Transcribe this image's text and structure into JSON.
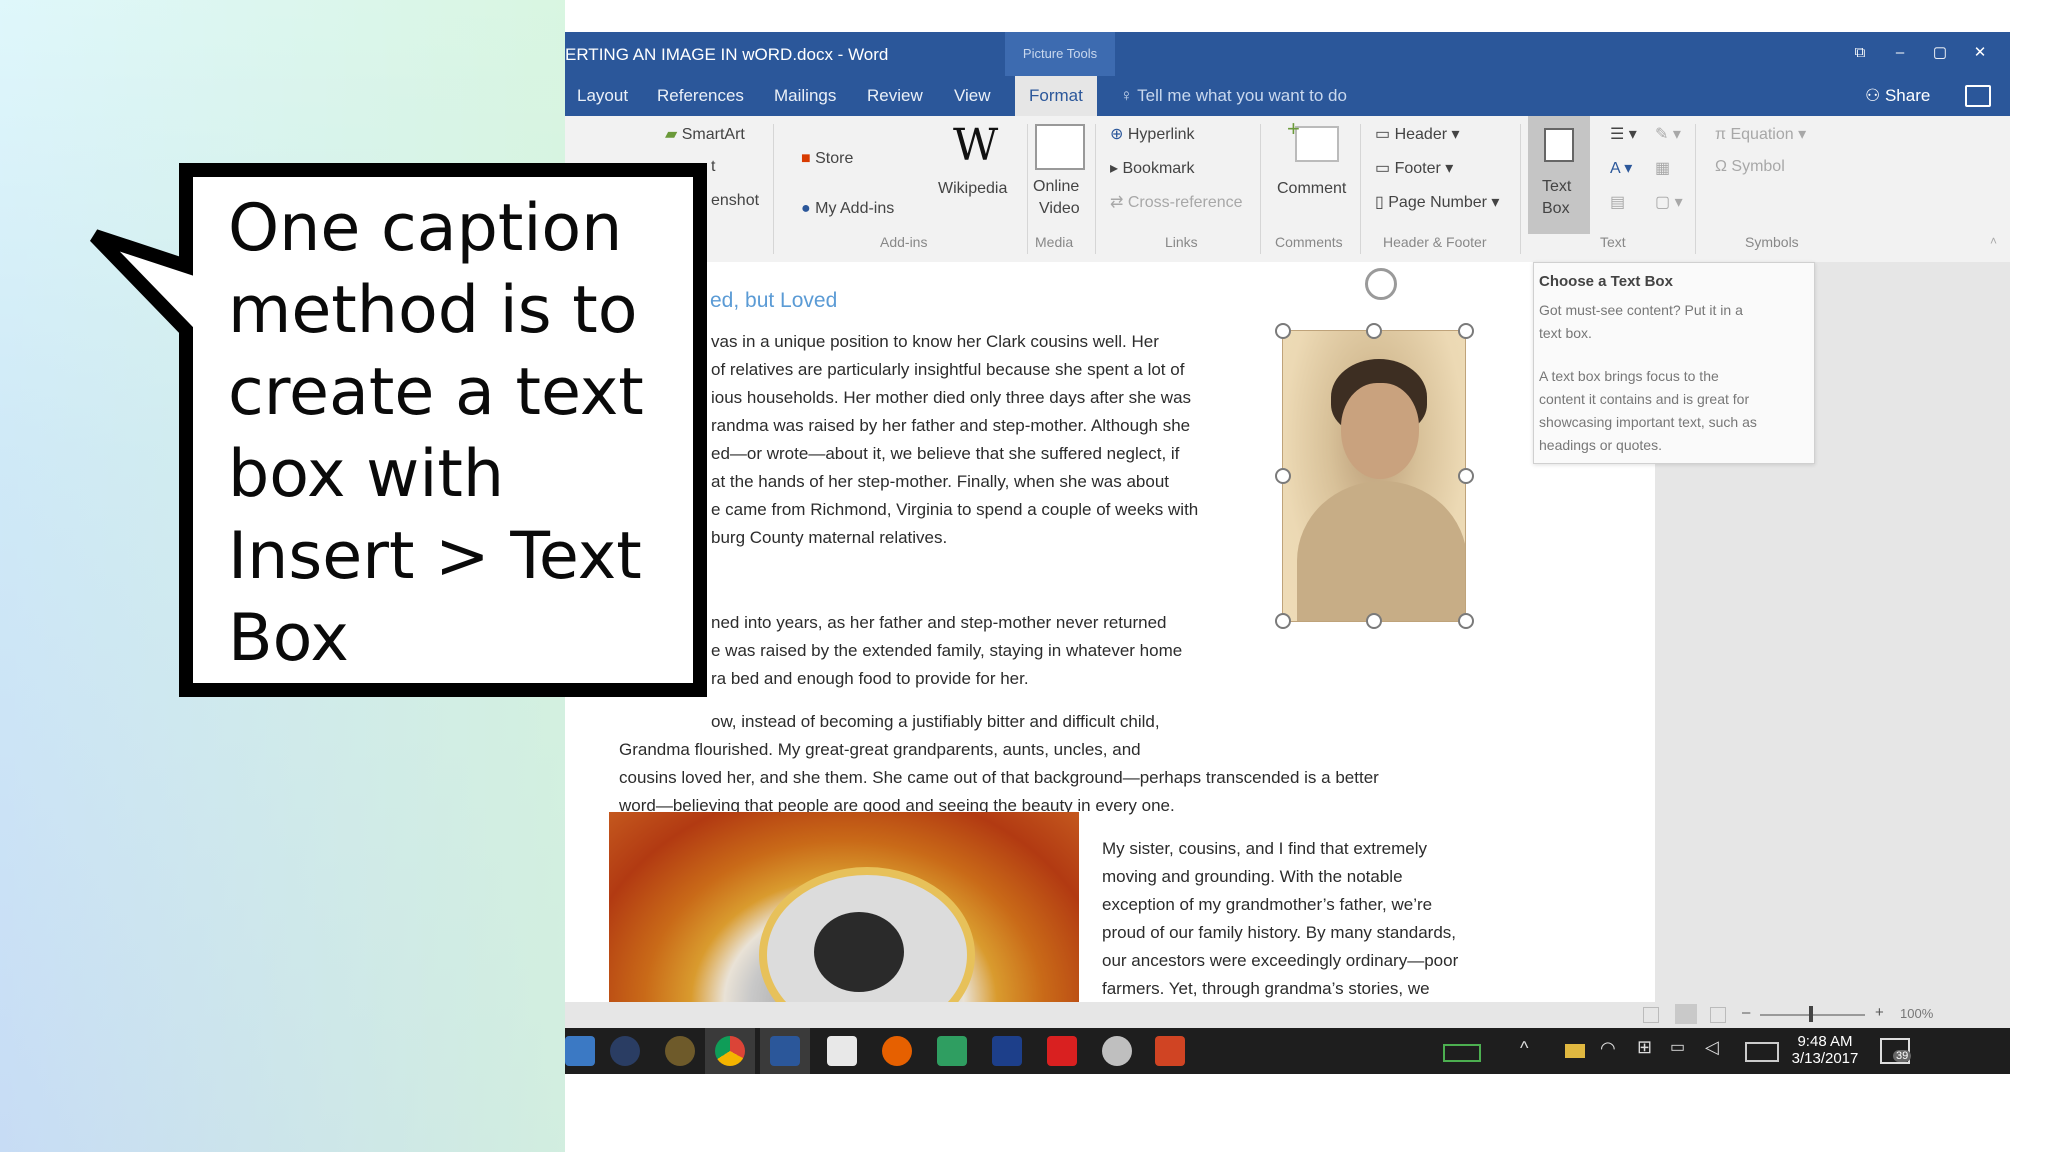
{
  "window": {
    "title": "ERTING AN IMAGE IN wORD.docx  -  Word",
    "contextual_tab": "Picture Tools",
    "controls": [
      "⧉",
      "–",
      "▢",
      "✕"
    ]
  },
  "tabs": [
    {
      "label": "Layout"
    },
    {
      "label": "References"
    },
    {
      "label": "Mailings"
    },
    {
      "label": "Review"
    },
    {
      "label": "View"
    },
    {
      "label": "Format"
    }
  ],
  "tell_me": "Tell me what you want to do",
  "share": "Share",
  "ribbon": {
    "illustrations": {
      "smartart": "SmartArt",
      "chart_partial": "t",
      "screenshot_partial": "enshot"
    },
    "addins": {
      "store": "Store",
      "my_addins": "My Add-ins",
      "wikipedia": "Wikipedia",
      "group": "Add-ins"
    },
    "media": {
      "online_video": "Online",
      "online_video2": "Video",
      "group": "Media"
    },
    "links": {
      "hyperlink": "Hyperlink",
      "bookmark": "Bookmark",
      "cross_reference": "Cross-reference",
      "group": "Links"
    },
    "comments": {
      "comment": "Comment",
      "group": "Comments"
    },
    "header_footer": {
      "header": "Header",
      "footer": "Footer",
      "page_number": "Page Number",
      "group": "Header & Footer"
    },
    "text": {
      "text_box": "Text",
      "text_box2": "Box",
      "group": "Text"
    },
    "symbols": {
      "equation": "Equation",
      "symbol": "Symbol",
      "group": "Symbols"
    }
  },
  "tooltip": {
    "title": "Choose a Text Box",
    "line1": "Got must-see content? Put it in a",
    "line2": "text box.",
    "line3": "A text box brings focus to the",
    "line4": "content it contains and is great for",
    "line5": "showcasing important text, such as",
    "line6": "headings or quotes."
  },
  "document": {
    "heading": "ed, but Loved",
    "para1": [
      "vas in a unique position to know her Clark cousins well. Her",
      "of relatives are particularly insightful because she spent a lot of",
      "ious households. Her mother died only three days after she was",
      "randma was raised by her father and step-mother. Although she",
      "ed—or wrote—about it, we believe that she suffered neglect, if",
      "at the hands of her step-mother. Finally, when she was about",
      "e came from Richmond, Virginia to spend a couple of weeks with",
      "burg County maternal relatives."
    ],
    "para2": [
      "ned into years, as her father and step-mother never returned",
      "e was raised by the extended family, staying in whatever home",
      "ra bed and enough food to provide for her."
    ],
    "para3": [
      "ow, instead of becoming a justifiably bitter and difficult child,",
      "Grandma flourished. My great-great grandparents, aunts, uncles, and",
      "cousins loved her, and she them. She came out of that background—perhaps transcended is a better",
      "word—believing that people are good and seeing the beauty in every one."
    ],
    "para4": [
      "My sister, cousins, and I find that extremely",
      "moving and grounding. With the notable",
      "exception of my grandmother’s father, we’re",
      "proud of our family history. By many standards,",
      "our ancestors were exceedingly ordinary—poor",
      "farmers. Yet, through grandma’s stories, we"
    ]
  },
  "statusbar": {
    "zoom": "100%",
    "minus": "–",
    "plus": "+"
  },
  "taskbar": {
    "time": "9:48 AM",
    "date": "3/13/2017",
    "notif_count": "39"
  },
  "callout": {
    "lines": [
      "One caption",
      "method is to",
      "create a text",
      "box with",
      "Insert > Text",
      "Box"
    ]
  }
}
